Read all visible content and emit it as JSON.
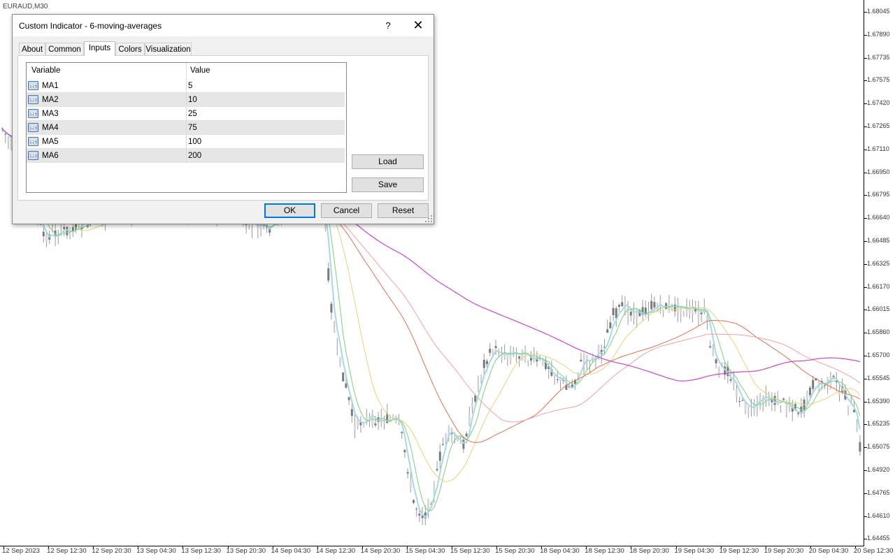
{
  "chart": {
    "symbol": "EURAUD,M30",
    "price_levels": [
      "1.68045",
      "1.67890",
      "1.67735",
      "1.67575",
      "1.67420",
      "1.67265",
      "1.67110",
      "1.66950",
      "1.66795",
      "1.66640",
      "1.66485",
      "1.66325",
      "1.66170",
      "1.66015",
      "1.65860",
      "1.65700",
      "1.65545",
      "1.65390",
      "1.65235",
      "1.65075",
      "1.64920",
      "1.64765",
      "1.64610",
      "1.64455"
    ],
    "time_labels": [
      "12 Sep 2023",
      "12 Sep 12:30",
      "12 Sep 20:30",
      "13 Sep 04:30",
      "13 Sep 12:30",
      "13 Sep 20:30",
      "14 Sep 04:30",
      "14 Sep 12:30",
      "14 Sep 20:30",
      "15 Sep 04:30",
      "15 Sep 12:30",
      "15 Sep 20:30",
      "18 Sep 04:30",
      "18 Sep 12:30",
      "18 Sep 20:30",
      "19 Sep 04:30",
      "19 Sep 12:30",
      "19 Sep 20:30",
      "20 Sep 04:30",
      "20 Sep 12:30"
    ],
    "colors": {
      "candle_body": "#7a7a7a",
      "candle_wick": "#9a9a9a",
      "ma1": "#a8d8e8",
      "ma2": "#7bd07b",
      "ma3": "#e8d27a",
      "ma4": "#e07050",
      "ma5": "#f0a0a8",
      "ma6": "#cc44cc"
    }
  },
  "dialog": {
    "title": "Custom Indicator - 6-moving-averages",
    "help": "?",
    "close": "✕",
    "tabs": [
      "About",
      "Common",
      "Inputs",
      "Colors",
      "Visualization"
    ],
    "active_tab": "Inputs",
    "columns": {
      "variable": "Variable",
      "value": "Value"
    },
    "rows": [
      {
        "icon": "numeric-icon",
        "name": "MA1",
        "value": "5"
      },
      {
        "icon": "numeric-icon",
        "name": "MA2",
        "value": "10"
      },
      {
        "icon": "numeric-icon",
        "name": "MA3",
        "value": "25"
      },
      {
        "icon": "numeric-icon",
        "name": "MA4",
        "value": "75"
      },
      {
        "icon": "numeric-icon",
        "name": "MA5",
        "value": "100"
      },
      {
        "icon": "numeric-icon",
        "name": "MA6",
        "value": "200"
      }
    ],
    "buttons": {
      "load": "Load",
      "save": "Save",
      "ok": "OK",
      "cancel": "Cancel",
      "reset": "Reset"
    }
  }
}
